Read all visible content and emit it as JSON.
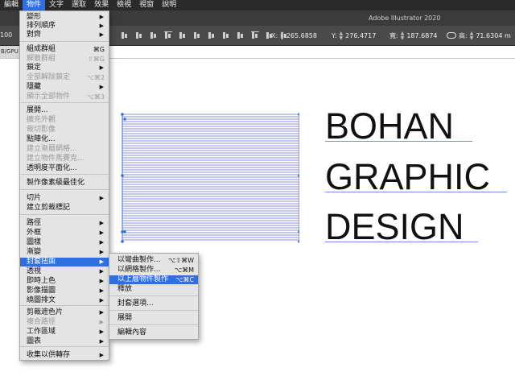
{
  "menubar": {
    "items": [
      "編輯",
      "物件",
      "文字",
      "選取",
      "效果",
      "檢視",
      "視窗",
      "說明"
    ],
    "active_index": 1
  },
  "titlebar": {
    "title": "Adobe Illustrator 2020"
  },
  "controlbar": {
    "left_value": "100",
    "x_label": "X:",
    "x_value": "265.6858",
    "y_label": "Y:",
    "y_value": "276.4717",
    "w_label": "寬:",
    "w_value": "187.6874",
    "h_label": "高:",
    "h_value": "71.6304 m"
  },
  "doc_tab": {
    "label": "B/GPU"
  },
  "artwork": {
    "lines": [
      "BOHAN",
      "GRAPHIC",
      "DESIGN"
    ],
    "stripe_color": "#8a8fd6",
    "selection_color": "#2f6fe0"
  },
  "object_menu": {
    "items": [
      {
        "label": "變形",
        "arrow": "▶",
        "shortcut": "",
        "disabled": false
      },
      {
        "label": "排列順序",
        "arrow": "▶",
        "shortcut": "",
        "disabled": false
      },
      {
        "label": "對齊",
        "arrow": "▶",
        "shortcut": "",
        "disabled": false
      },
      {
        "label": "組成群組",
        "arrow": "",
        "shortcut": "⌘G",
        "disabled": false
      },
      {
        "label": "解散群組",
        "arrow": "",
        "shortcut": "⇧⌘G",
        "disabled": true
      },
      {
        "label": "鎖定",
        "arrow": "▶",
        "shortcut": "",
        "disabled": false
      },
      {
        "label": "全部解除鎖定",
        "arrow": "",
        "shortcut": "⌥⌘2",
        "disabled": true
      },
      {
        "label": "隱藏",
        "arrow": "▶",
        "shortcut": "",
        "disabled": false
      },
      {
        "label": "顯示全部物件",
        "arrow": "",
        "shortcut": "⌥⌘3",
        "disabled": true
      },
      {
        "label": "展開...",
        "arrow": "",
        "shortcut": "",
        "disabled": false
      },
      {
        "label": "擴充外觀",
        "arrow": "",
        "shortcut": "",
        "disabled": true
      },
      {
        "label": "裁切影像",
        "arrow": "",
        "shortcut": "",
        "disabled": true
      },
      {
        "label": "點陣化...",
        "arrow": "",
        "shortcut": "",
        "disabled": false
      },
      {
        "label": "建立漸層網格...",
        "arrow": "",
        "shortcut": "",
        "disabled": true
      },
      {
        "label": "建立物件馬賽克...",
        "arrow": "",
        "shortcut": "",
        "disabled": true
      },
      {
        "label": "透明度平面化...",
        "arrow": "",
        "shortcut": "",
        "disabled": false
      },
      {
        "label": "製作像素級最佳化",
        "arrow": "",
        "shortcut": "",
        "disabled": false
      },
      {
        "label": "切片",
        "arrow": "▶",
        "shortcut": "",
        "disabled": false
      },
      {
        "label": "建立剪裁標記",
        "arrow": "",
        "shortcut": "",
        "disabled": false
      },
      {
        "label": "路徑",
        "arrow": "▶",
        "shortcut": "",
        "disabled": false
      },
      {
        "label": "外框",
        "arrow": "▶",
        "shortcut": "",
        "disabled": false
      },
      {
        "label": "圖樣",
        "arrow": "▶",
        "shortcut": "",
        "disabled": false
      },
      {
        "label": "漸變",
        "arrow": "▶",
        "shortcut": "",
        "disabled": false
      },
      {
        "label": "封套扭曲",
        "arrow": "▶",
        "shortcut": "",
        "disabled": false
      },
      {
        "label": "透視",
        "arrow": "▶",
        "shortcut": "",
        "disabled": false
      },
      {
        "label": "即時上色",
        "arrow": "▶",
        "shortcut": "",
        "disabled": false
      },
      {
        "label": "影像描圖",
        "arrow": "▶",
        "shortcut": "",
        "disabled": false
      },
      {
        "label": "繞圖排文",
        "arrow": "▶",
        "shortcut": "",
        "disabled": false
      },
      {
        "label": "剪裁遮色片",
        "arrow": "▶",
        "shortcut": "",
        "disabled": false
      },
      {
        "label": "複合路徑",
        "arrow": "▶",
        "shortcut": "",
        "disabled": true
      },
      {
        "label": "工作區域",
        "arrow": "▶",
        "shortcut": "",
        "disabled": false
      },
      {
        "label": "圖表",
        "arrow": "▶",
        "shortcut": "",
        "disabled": false
      },
      {
        "label": "收集以供轉存",
        "arrow": "▶",
        "shortcut": "",
        "disabled": false
      }
    ],
    "highlighted_index": 23
  },
  "envelope_submenu": {
    "items": [
      {
        "label": "以彎曲製作...",
        "shortcut": "⌥⇧⌘W"
      },
      {
        "label": "以網格製作...",
        "shortcut": "⌥⌘M"
      },
      {
        "label": "以上層物件製作",
        "shortcut": "⌥⌘C"
      },
      {
        "label": "釋放",
        "shortcut": ""
      },
      {
        "label": "封套選項...",
        "shortcut": ""
      },
      {
        "label": "展開",
        "shortcut": ""
      },
      {
        "label": "編輯內容",
        "shortcut": ""
      }
    ],
    "highlighted_index": 2
  }
}
